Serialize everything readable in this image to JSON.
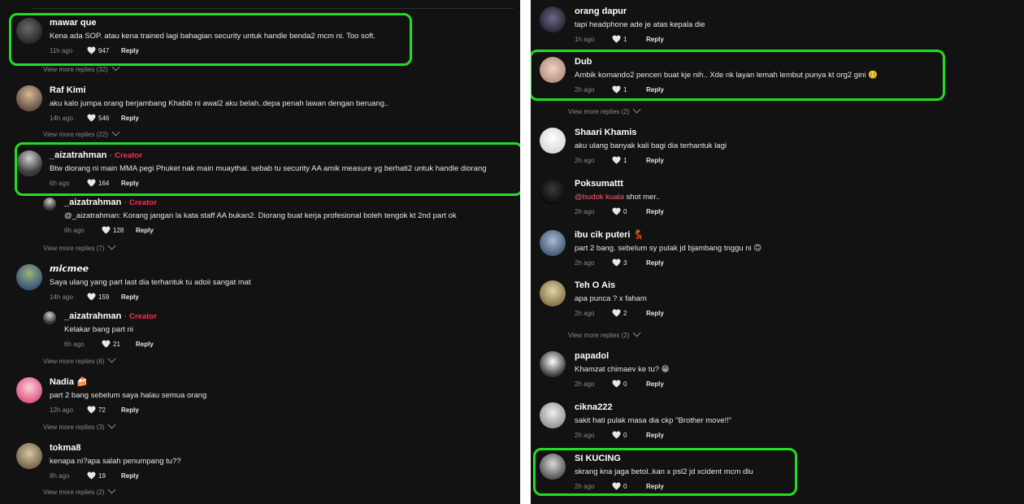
{
  "colors": {
    "background": "#121212",
    "highlight": "#22dd22",
    "creator": "#fe2c55",
    "mention": "#fe5c72"
  },
  "left": {
    "comments": [
      {
        "user": "mawar que",
        "text": "Kena ada SOP. atau kena trained lagi bahagian security untuk handle benda2 mcm ni. Too soft.",
        "time": "11h ago",
        "likes": "947",
        "reply": "Reply"
      },
      {
        "user": "Raf Kimi",
        "text": "aku kalo jumpa orang berjambang Khabib ni awal2 aku belah..depa penah lawan dengan beruang..",
        "time": "14h ago",
        "likes": "546",
        "reply": "Reply"
      },
      {
        "user": "_aizatrahman",
        "badge_sep": "·",
        "badge": "Creator",
        "text": "Btw diorang ni main MMA pegi Phuket nak main muaythai. sebab tu security AA amik measure yg berhati2 untuk handle diorang",
        "time": "6h ago",
        "likes": "164",
        "reply": "Reply"
      },
      {
        "user": "_aizatrahman",
        "badge_sep": "·",
        "badge": "Creator",
        "text": "@_aizatrahman: Korang jangan la kata staff AA bukan2. Diorang buat kerja profesional boleh tengok kt 2nd part ok",
        "time": "6h ago",
        "likes": "128",
        "reply": "Reply"
      },
      {
        "user": "𝙢𝙞𝙘𝙢𝙚𝙚",
        "text": "Saya ulang yang part last dia terhantuk tu adoii sangat mat",
        "time": "14h ago",
        "likes": "159",
        "reply": "Reply"
      },
      {
        "user": "_aizatrahman",
        "badge_sep": "·",
        "badge": "Creator",
        "text": "Kelakar bang part ni",
        "time": "6h ago",
        "likes": "21",
        "reply": "Reply"
      },
      {
        "user": "Nadia 🍰",
        "text": "part 2 bang sebelum saya halau semua orang",
        "time": "12h ago",
        "likes": "72",
        "reply": "Reply"
      },
      {
        "user": "tokma8",
        "text": "kenapa ni?apa salah penumpang tu??",
        "time": "8h ago",
        "likes": "19",
        "reply": "Reply"
      }
    ],
    "more": [
      "View more replies (32)",
      "View more replies (22)",
      "View more replies (7)",
      "View more replies (6)",
      "View more replies (3)",
      "View more replies (2)"
    ]
  },
  "right": {
    "comments": [
      {
        "user": "orang dapur",
        "text": "tapi headphone ade je atas kepala die",
        "time": "1h ago",
        "likes": "1",
        "reply": "Reply"
      },
      {
        "user": "Dub",
        "text": "Ambik komando2 pencen buat kje nih.. Xde nk layan lemah lembut punya kt org2 gini 🥴",
        "time": "2h ago",
        "likes": "1",
        "reply": "Reply"
      },
      {
        "user": "Shaari Khamis",
        "text": "aku ulang banyak kali bagi dia terhantuk lagi",
        "time": "2h ago",
        "likes": "1",
        "reply": "Reply"
      },
      {
        "user": "Poksumattt",
        "mention": "@budok kuala",
        "text": " shot mer..",
        "time": "2h ago",
        "likes": "0",
        "reply": "Reply"
      },
      {
        "user": "ibu cik puteri 💃",
        "text": "part 2 bang. sebelum sy pulak jd bjambang tnggu ni 🙃",
        "time": "2h ago",
        "likes": "3",
        "reply": "Reply"
      },
      {
        "user": "Teh O Ais",
        "text": "apa punca ? x faham",
        "time": "2h ago",
        "likes": "2",
        "reply": "Reply"
      },
      {
        "user": "papadol",
        "text": "Khamzat chimaev ke tu? 😁",
        "time": "2h ago",
        "likes": "0",
        "reply": "Reply"
      },
      {
        "user": "cikna222",
        "text": "sakit hati pulak masa dia ckp \"Brother move!!\"",
        "time": "2h ago",
        "likes": "0",
        "reply": "Reply"
      },
      {
        "user": "SI KUCING",
        "text": "skrang kna jaga betol..kan x psl2 jd xcident mcm dlu",
        "time": "2h ago",
        "likes": "0",
        "reply": "Reply"
      }
    ],
    "more": [
      "View more replies (2)",
      "View more replies (2)"
    ]
  }
}
